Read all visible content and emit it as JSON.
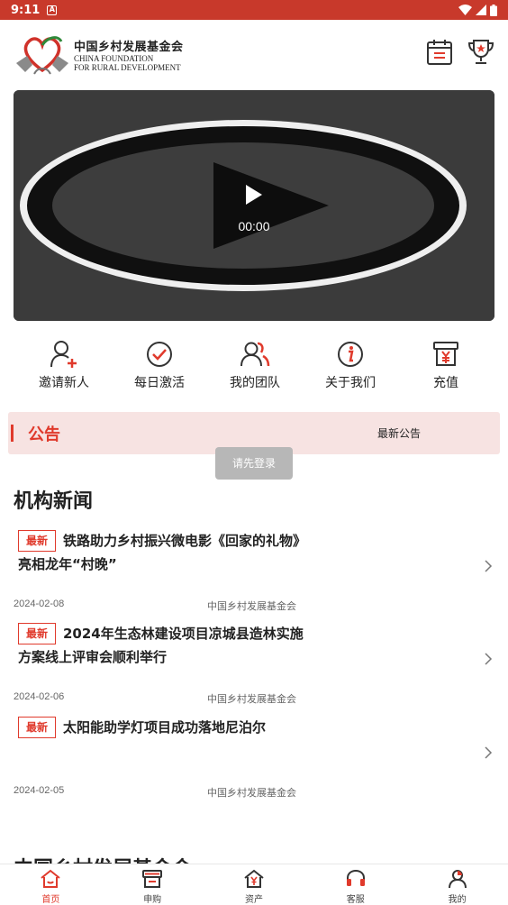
{
  "status_bar": {
    "time": "9:11",
    "notif_icon": "A"
  },
  "header": {
    "logo_cn": "中国乡村发展基金会",
    "logo_en_line1": "CHINA FOUNDATION",
    "logo_en_line2": "FOR RURAL DEVELOPMENT",
    "icons": [
      "calendar-icon",
      "trophy-icon"
    ]
  },
  "video": {
    "time": "00:00"
  },
  "quick_menu": [
    {
      "label": "邀请新人",
      "icon": "invite-user-icon"
    },
    {
      "label": "每日激活",
      "icon": "check-circle-icon"
    },
    {
      "label": "我的团队",
      "icon": "team-icon"
    },
    {
      "label": "关于我们",
      "icon": "info-icon"
    },
    {
      "label": "充值",
      "icon": "recharge-icon"
    }
  ],
  "notice": {
    "title": "公告",
    "latest": "最新公告"
  },
  "toast": "请先登录",
  "news": {
    "section_title": "机构新闻",
    "items": [
      {
        "tag": "最新",
        "title": "铁路助力乡村振兴微电影《回家的礼物》亮相龙年“村晚”",
        "date": "2024-02-08",
        "source": "中国乡村发展基金会"
      },
      {
        "tag": "最新",
        "title": "2024年生态林建设项目凉城县造林实施方案线上评审会顺利举行",
        "date": "2024-02-06",
        "source": "中国乡村发展基金会"
      },
      {
        "tag": "最新",
        "title": "太阳能助学灯项目成功落地尼泊尔",
        "date": "2024-02-05",
        "source": "中国乡村发展基金会"
      }
    ]
  },
  "next_section_title": "中国乡村发展基金会",
  "bottom_nav": [
    {
      "label": "首页",
      "icon": "home-icon",
      "active": true
    },
    {
      "label": "申购",
      "icon": "shop-icon",
      "active": false
    },
    {
      "label": "资产",
      "icon": "assets-icon",
      "active": false
    },
    {
      "label": "客服",
      "icon": "headset-icon",
      "active": false
    },
    {
      "label": "我的",
      "icon": "profile-icon",
      "active": false
    }
  ],
  "colors": {
    "status_bar": "#c8392b",
    "accent": "#e03a2c",
    "notice_bg": "#f7e3e2"
  }
}
